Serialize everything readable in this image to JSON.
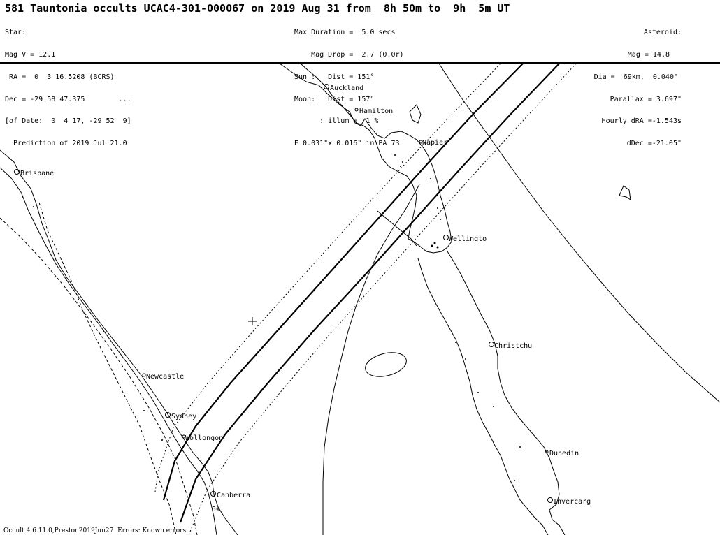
{
  "title": "581 Tauntonia occults UCAC4-301-000067 on 2019 Aug 31 from  8h 50m to  9h  5m UT",
  "star_block": [
    "Star:",
    "Mag V = 12.1",
    " RA =  0  3 16.5208 (BCRS)",
    "Dec = -29 58 47.375        ...",
    "[of Date:  0  4 17, -29 52  9]",
    "  Prediction of 2019 Jul 21.0"
  ],
  "event_block": [
    "Max Duration =  5.0 secs",
    "    Mag Drop =  2.7 (0.0r)",
    "Sun :   Dist = 151°",
    "Moon:   Dist = 157°",
    "      : illum =  1 %",
    "E 0.031\"x 0.016\" in PA 73"
  ],
  "asteroid_block": [
    "Asteroid:",
    "Mag = 14.8",
    "Dia =  69km,  0.040\"",
    "Parallax = 3.697\"",
    "Hourly dRA =-1.543s",
    "dDec =-21.05\""
  ],
  "cities": [
    {
      "name": "Brisbane"
    },
    {
      "name": "Auckland"
    },
    {
      "name": "Hamilton"
    },
    {
      "name": "Napier"
    },
    {
      "name": "Wellingto"
    },
    {
      "name": "Christchu"
    },
    {
      "name": "Newcastle"
    },
    {
      "name": "Sydney"
    },
    {
      "name": "Wollongon"
    },
    {
      "name": "Canberra"
    },
    {
      "name": "Dunedin"
    },
    {
      "name": "Invercarg"
    }
  ],
  "markers": {
    "star_marker": "5+"
  },
  "footer": "Occult 4.6.11.0,Preston2019Jun27  Errors: Known errors",
  "colors": {
    "background": "#ffffff",
    "ink": "#000000"
  }
}
